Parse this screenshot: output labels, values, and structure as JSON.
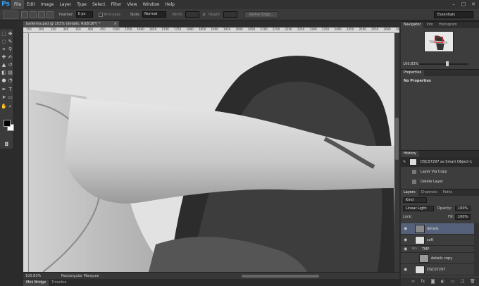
{
  "app": {
    "logo": "Ps"
  },
  "menu": [
    "File",
    "Edit",
    "Image",
    "Layer",
    "Type",
    "Select",
    "Filter",
    "View",
    "Window",
    "Help"
  ],
  "window_controls": [
    "–",
    "□",
    "✕"
  ],
  "options": {
    "feather_label": "Feather:",
    "feather_value": "0 px",
    "anti_alias_label": "Anti-alias",
    "style_label": "Style:",
    "style_value": "Normal",
    "width_label": "Width:",
    "height_label": "Height:",
    "refine_edge": "Refine Edge...",
    "workspace": "Essentials"
  },
  "document": {
    "tab_title": "ballerina.psd @ 101% (details, RGB/16*) *",
    "tab_close": "×",
    "ruler_marks": [
      "150",
      "200",
      "250",
      "300",
      "350",
      "400",
      "450",
      "1500",
      "1550",
      "1600",
      "1650",
      "1700",
      "1750",
      "1800",
      "1850",
      "1900",
      "1950",
      "2000",
      "2050",
      "2100",
      "2150",
      "2200",
      "2250",
      "2300",
      "2350",
      "2400",
      "2450",
      "2500",
      "2550",
      "2600",
      "2650"
    ],
    "zoom": "100.83%",
    "status_tool": "Rectangular Marquee"
  },
  "bottom_tabs": [
    "Mini Bridge",
    "Timeline"
  ],
  "navigator": {
    "tabs": [
      "Navigator",
      "Info",
      "Histogram"
    ],
    "zoom": "100.83%"
  },
  "properties": {
    "tab": "Properties",
    "empty_text": "No Properties"
  },
  "history": {
    "tab": "History",
    "items": [
      "DSC07297 as Smart Object-1",
      "Layer Via Copy",
      "Delete Layer"
    ]
  },
  "layers": {
    "tabs": [
      "Layers",
      "Channels",
      "Paths"
    ],
    "kind_label": "Kind",
    "blend_mode": "Linear Light",
    "opacity_label": "Opacity:",
    "opacity_value": "100%",
    "lock_label": "Lock:",
    "fill_label": "Fill:",
    "fill_value": "100%",
    "items": [
      {
        "name": "details"
      },
      {
        "name": "soft"
      },
      {
        "name": "TMP"
      },
      {
        "name": "details copy"
      },
      {
        "name": "DSC07297"
      }
    ]
  },
  "colors": {
    "accent": "#31a8ff",
    "selected_layer": "#55607a"
  }
}
